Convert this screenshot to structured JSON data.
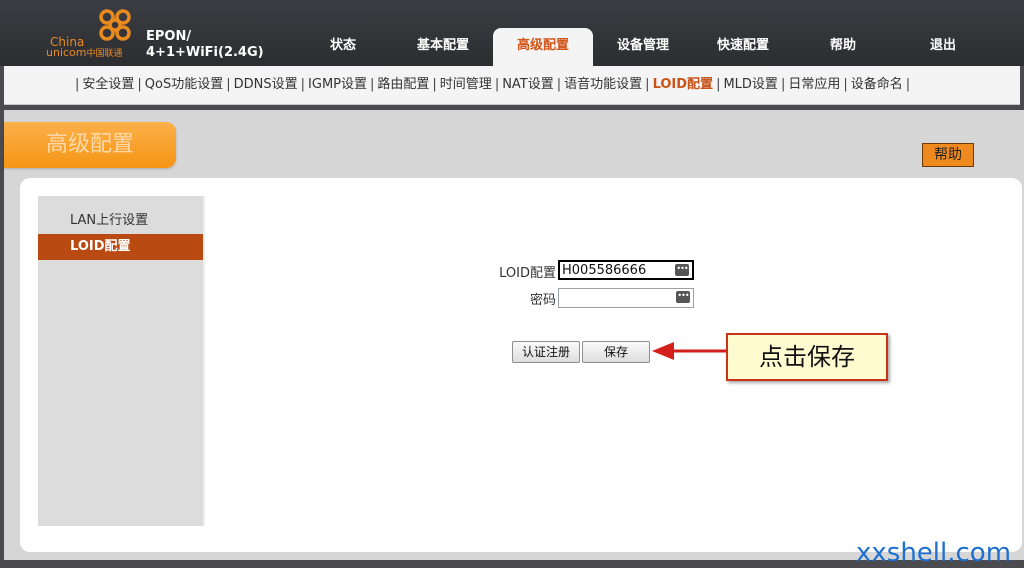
{
  "brand": {
    "name_en_line1": "China",
    "name_en_line2": "unicom",
    "name_cn": "中国联通",
    "model_line1": "EPON/",
    "model_line2": "4+1+WiFi(2.4G)",
    "color": "#e98a1f"
  },
  "nav": [
    {
      "label": "状态",
      "active": false
    },
    {
      "label": "基本配置",
      "active": false
    },
    {
      "label": "高级配置",
      "active": true
    },
    {
      "label": "设备管理",
      "active": false
    },
    {
      "label": "快速配置",
      "active": false
    },
    {
      "label": "帮助",
      "active": false
    },
    {
      "label": "退出",
      "active": false
    }
  ],
  "subnav": [
    {
      "label": "安全设置",
      "active": false
    },
    {
      "label": "QoS功能设置",
      "active": false
    },
    {
      "label": "DDNS设置",
      "active": false
    },
    {
      "label": "IGMP设置",
      "active": false
    },
    {
      "label": "路由配置",
      "active": false
    },
    {
      "label": "时间管理",
      "active": false
    },
    {
      "label": "NAT设置",
      "active": false
    },
    {
      "label": "语音功能设置",
      "active": false
    },
    {
      "label": "LOID配置",
      "active": true
    },
    {
      "label": "MLD设置",
      "active": false
    },
    {
      "label": "日常应用",
      "active": false
    },
    {
      "label": "设备命名",
      "active": false
    }
  ],
  "page": {
    "tab_title": "高级配置",
    "help_label": "帮助",
    "accent_color": "#f59514"
  },
  "sidebar": [
    {
      "label": "LAN上行设置",
      "active": false
    },
    {
      "label": "LOID配置",
      "active": true
    }
  ],
  "form": {
    "loid_label": "LOID配置",
    "loid_value": "H005586666",
    "password_label": "密码",
    "password_value": "",
    "auth_button": "认证注册",
    "save_button": "保存"
  },
  "annotation": {
    "text": "点击保存",
    "arrow_color": "#d4201a"
  },
  "watermark": "xxshell.com"
}
